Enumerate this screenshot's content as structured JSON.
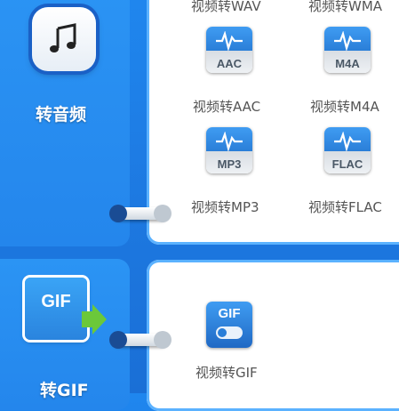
{
  "categories": [
    {
      "id": "audio",
      "label": "转音频",
      "icon": "music-note-icon",
      "formats": [
        {
          "label": "视频转WAV"
        },
        {
          "label": "视频转WMA"
        },
        {
          "label": "视频转AAC",
          "badge": "AAC",
          "icon": "waveform-icon"
        },
        {
          "label": "视频转M4A",
          "badge": "M4A",
          "icon": "waveform-icon"
        },
        {
          "label": "视频转MP3",
          "badge": "MP3",
          "icon": "waveform-icon"
        },
        {
          "label": "视频转FLAC",
          "badge": "FLAC",
          "icon": "waveform-icon"
        }
      ]
    },
    {
      "id": "gif",
      "label": "转GIF",
      "icon": "gif-file-icon",
      "icon_text": "GIF",
      "formats": [
        {
          "label": "视频转GIF",
          "badge": "GIF",
          "icon": "gif-toggle-icon"
        }
      ]
    }
  ],
  "colors": {
    "background": "#1f86ee",
    "panel_border": "#5bb2ff",
    "label_text": "#555555",
    "gif_green": "#6bc83a"
  }
}
